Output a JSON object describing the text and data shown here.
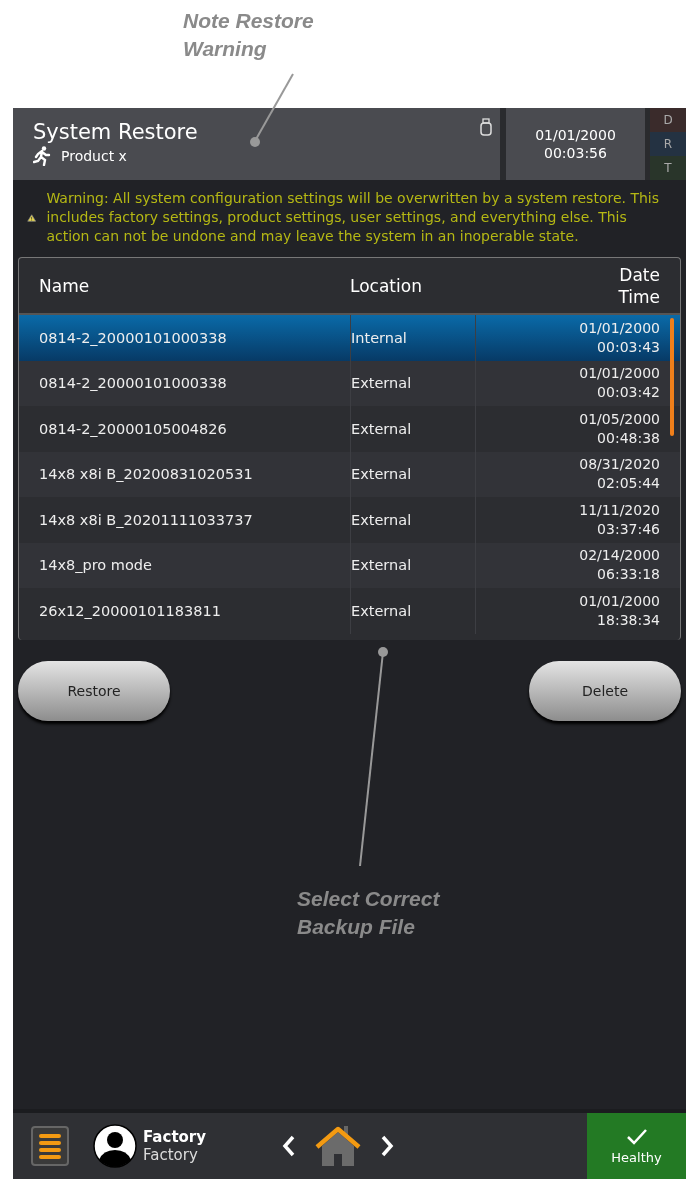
{
  "annotations": [
    {
      "lines": [
        "Note Restore",
        "Warning"
      ]
    },
    {
      "lines": [
        "Select Correct",
        "Backup File"
      ]
    }
  ],
  "header": {
    "title": "System Restore",
    "subtitle": "Product x",
    "date": "01/01/2000",
    "time": "00:03:56",
    "indicators": [
      {
        "label": "D",
        "color": "#3a2b2b"
      },
      {
        "label": "R",
        "color": "#243242"
      },
      {
        "label": "T",
        "color": "#29352a"
      }
    ]
  },
  "warning": "Warning: All system configuration settings will be overwritten by a system restore. This includes factory settings, product settings, user settings, and everything else. This action can not be undone and may leave the system in an inoperable state.",
  "table": {
    "columns": [
      "Name",
      "Location",
      [
        "Date",
        "Time"
      ]
    ],
    "rows": [
      {
        "name": "0814-2_20000101000338",
        "location": "Internal",
        "date": "01/01/2000",
        "time": "00:03:43",
        "selected": true
      },
      {
        "name": "0814-2_20000101000338",
        "location": "External",
        "date": "01/01/2000",
        "time": "00:03:42",
        "selected": false
      },
      {
        "name": "0814-2_20000105004826",
        "location": "External",
        "date": "01/05/2000",
        "time": "00:48:38",
        "selected": false
      },
      {
        "name": "14x8 x8i B_20200831020531",
        "location": "External",
        "date": "08/31/2020",
        "time": "02:05:44",
        "selected": false
      },
      {
        "name": "14x8 x8i B_20201111033737",
        "location": "External",
        "date": "11/11/2020",
        "time": "03:37:46",
        "selected": false
      },
      {
        "name": "14x8_pro mode",
        "location": "External",
        "date": "02/14/2000",
        "time": "06:33:18",
        "selected": false
      },
      {
        "name": "26x12_20000101183811",
        "location": "External",
        "date": "01/01/2000",
        "time": "18:38:34",
        "selected": false
      }
    ]
  },
  "buttons": [
    "Restore",
    "Delete"
  ],
  "footer": {
    "user_name": "Factory",
    "user_role": "Factory",
    "status": "Healthy"
  }
}
